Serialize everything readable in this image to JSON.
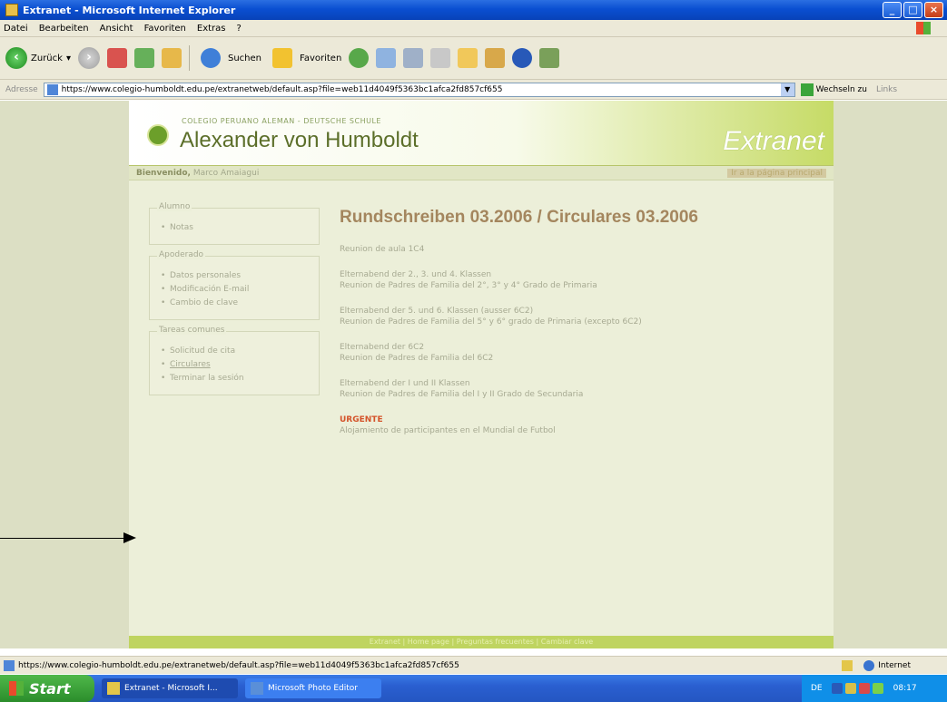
{
  "window": {
    "title": "Extranet - Microsoft Internet Explorer"
  },
  "menu": [
    "Datei",
    "Bearbeiten",
    "Ansicht",
    "Favoriten",
    "Extras",
    "?"
  ],
  "toolbar": {
    "back": "Zurück",
    "search": "Suchen",
    "favorites": "Favoriten"
  },
  "address": {
    "label": "Adresse",
    "url": "https://www.colegio-humboldt.edu.pe/extranetweb/default.asp?file=web11d4049f5363bc1afca2fd857cf655",
    "go": "Wechseln zu",
    "links": "Links"
  },
  "site": {
    "school_sub": "COLEGIO PERUANO ALEMAN - DEUTSCHE SCHULE",
    "school_name": "Alexander von Humboldt",
    "extranet": "Extranet",
    "welcome_label": "Bienvenido,",
    "welcome_name": "Marco Amaiagui",
    "homepage_link": "Ir a la página principal"
  },
  "sidebar": {
    "sections": [
      {
        "legend": "Alumno",
        "items": [
          "Notas"
        ]
      },
      {
        "legend": "Apoderado",
        "items": [
          "Datos personales",
          "Modificación E-mail",
          "Cambio de clave"
        ]
      },
      {
        "legend": "Tareas comunes",
        "items": [
          "Solicitud de cita",
          "Circulares",
          "Terminar la sesión"
        ]
      }
    ]
  },
  "content": {
    "title": "Rundschreiben 03.2006 / Circulares 03.2006",
    "items": [
      {
        "line1": "Reunion de aula 1C4",
        "line2": ""
      },
      {
        "line1": "Elternabend der 2., 3. und 4. Klassen",
        "line2": "Reunion de Padres de Familia del 2°, 3° y 4° Grado de Primaria"
      },
      {
        "line1": "Elternabend der 5. und 6. Klassen (ausser 6C2)",
        "line2": "Reunion de Padres de Familia del 5° y 6° grado de Primaria (excepto 6C2)"
      },
      {
        "line1": "Elternabend der 6C2",
        "line2": "Reunion de Padres de Familia del 6C2"
      },
      {
        "line1": "Elternabend der I und II Klassen",
        "line2": "Reunion de Padres de Familia del I y II Grado de Secundaria"
      }
    ],
    "urgent_label": "URGENTE",
    "urgent_text": "Alojamiento de participantes en el Mundial de Futbol"
  },
  "footer": {
    "text": "Extranet | Home page | Preguntas frecuentes | Cambiar clave"
  },
  "statusbar": {
    "url": "https://www.colegio-humboldt.edu.pe/extranetweb/default.asp?file=web11d4049f5363bc1afca2fd857cf655",
    "zone": "Internet"
  },
  "taskbar": {
    "start": "Start",
    "tasks": [
      "Extranet - Microsoft I...",
      "Microsoft Photo Editor"
    ],
    "tray_lang": "DE",
    "clock": "08:17"
  },
  "colors": {
    "site_green": "#bfd460",
    "title_brown": "#a4865e",
    "urgent": "#d4532a"
  }
}
